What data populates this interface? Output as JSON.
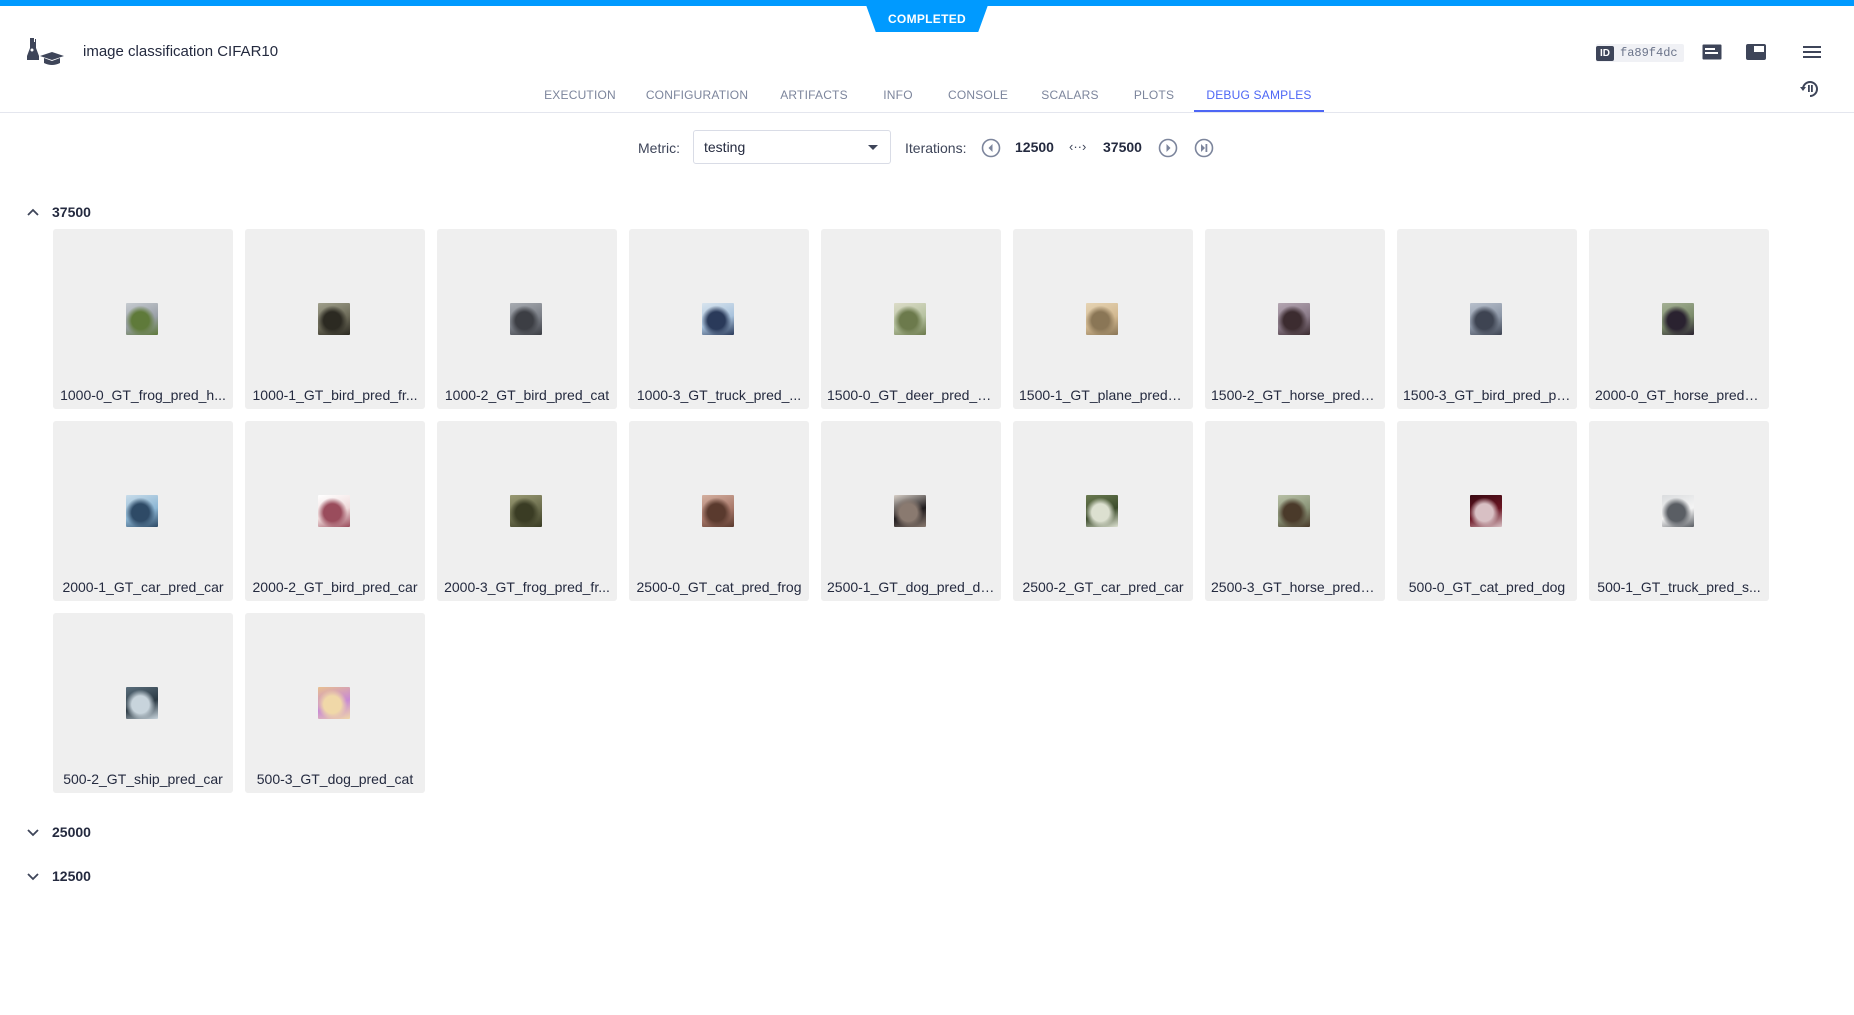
{
  "status": "COMPLETED",
  "experiment_title": "image classification CIFAR10",
  "experiment_id": {
    "label": "ID",
    "value": "fa89f4dc"
  },
  "tabs": [
    {
      "label": "EXECUTION",
      "active": false
    },
    {
      "label": "CONFIGURATION",
      "active": false
    },
    {
      "label": "ARTIFACTS",
      "active": false
    },
    {
      "label": "INFO",
      "active": false
    },
    {
      "label": "CONSOLE",
      "active": false
    },
    {
      "label": "SCALARS",
      "active": false
    },
    {
      "label": "PLOTS",
      "active": false
    },
    {
      "label": "DEBUG SAMPLES",
      "active": true
    }
  ],
  "toolbar": {
    "metric_label": "Metric:",
    "metric_value": "testing",
    "iterations_label": "Iterations:",
    "iter_min": "12500",
    "iter_range_arrow": "‹··›",
    "iter_max": "37500"
  },
  "groups": [
    {
      "label": "37500",
      "expanded": true
    },
    {
      "label": "25000",
      "expanded": false
    },
    {
      "label": "12500",
      "expanded": false
    }
  ],
  "samples": [
    {
      "label": "1000-0_GT_frog_pred_h...",
      "colors": [
        "#9aa0a8",
        "#5f7a3a",
        "#c6cbd0"
      ]
    },
    {
      "label": "1000-1_GT_bird_pred_fr...",
      "colors": [
        "#6c6a58",
        "#2c2a22",
        "#a0a08c"
      ]
    },
    {
      "label": "1000-2_GT_bird_pred_cat",
      "colors": [
        "#7a7e86",
        "#3c3e44",
        "#a8acb2"
      ]
    },
    {
      "label": "1000-3_GT_truck_pred_...",
      "colors": [
        "#a8c2dc",
        "#2a3a5a",
        "#d8e4ee"
      ]
    },
    {
      "label": "1500-0_GT_deer_pred_h...",
      "colors": [
        "#b6c2a0",
        "#6c7a4c",
        "#dcdcc8"
      ]
    },
    {
      "label": "1500-1_GT_plane_pred_...",
      "colors": [
        "#d2b890",
        "#8a7656",
        "#e6d4b4"
      ]
    },
    {
      "label": "1500-2_GT_horse_pred_...",
      "colors": [
        "#8a7a88",
        "#3c2c30",
        "#b4a6b2"
      ]
    },
    {
      "label": "1500-3_GT_bird_pred_pl...",
      "colors": [
        "#8c96a6",
        "#3e4452",
        "#b8c0cc"
      ]
    },
    {
      "label": "2000-0_GT_horse_pred_...",
      "colors": [
        "#7a8a6a",
        "#2a2230",
        "#a4b094"
      ]
    },
    {
      "label": "2000-1_GT_car_pred_car",
      "colors": [
        "#8cb6d4",
        "#2e4a66",
        "#c8dcea"
      ]
    },
    {
      "label": "2000-2_GT_bird_pred_car",
      "colors": [
        "#f0dcdc",
        "#9a4c5c",
        "#ffffff"
      ]
    },
    {
      "label": "2000-3_GT_frog_pred_fr...",
      "colors": [
        "#6a6c4c",
        "#3a3c24",
        "#9a9a74"
      ]
    },
    {
      "label": "2500-0_GT_cat_pred_frog",
      "colors": [
        "#a8786a",
        "#5a3a2e",
        "#d4b0a0"
      ]
    },
    {
      "label": "2500-1_GT_dog_pred_dog",
      "colors": [
        "#1e1a1c",
        "#8a7a70",
        "#d8d0c8"
      ]
    },
    {
      "label": "2500-2_GT_car_pred_car",
      "colors": [
        "#3c4c2c",
        "#dce0d0",
        "#6a7a50"
      ]
    },
    {
      "label": "2500-3_GT_horse_pred_...",
      "colors": [
        "#8a9478",
        "#4a3a2a",
        "#b8c0a6"
      ]
    },
    {
      "label": "500-0_GT_cat_pred_dog",
      "colors": [
        "#6a1422",
        "#d8c0c4",
        "#3a0a12"
      ]
    },
    {
      "label": "500-1_GT_truck_pred_s...",
      "colors": [
        "#f4f4f4",
        "#5a5e64",
        "#dadcde"
      ]
    },
    {
      "label": "500-2_GT_ship_pred_car",
      "colors": [
        "#2c3a44",
        "#c8d4dc",
        "#5a6e7c"
      ]
    },
    {
      "label": "500-3_GT_dog_pred_cat",
      "colors": [
        "#c88ad4",
        "#f0d8a8",
        "#e8c090"
      ]
    }
  ],
  "colors": {
    "accent": "#4d66f5",
    "status_bar": "#009aff",
    "card_bg": "#efefef"
  }
}
